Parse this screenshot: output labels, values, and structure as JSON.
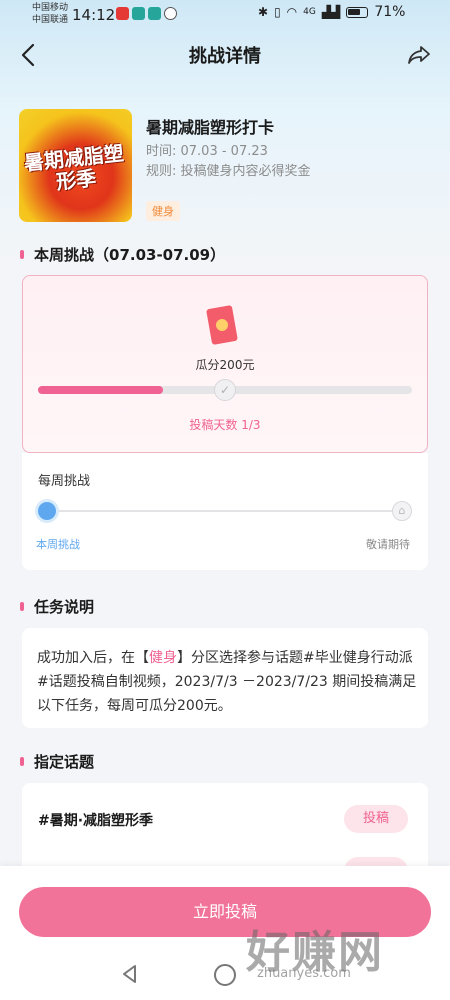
{
  "status_bar": {
    "carrier1": "中国移动",
    "carrier2": "中国联通",
    "time": "14:12",
    "network": "4G",
    "battery": "71%"
  },
  "header": {
    "title": "挑战详情"
  },
  "challenge": {
    "cover_text": "暑期减脂塑形季",
    "name": "暑期减脂塑形打卡",
    "time": "时间:  07.03 - 07.23",
    "rule": "规则:  投稿健身内容必得奖金",
    "tag": "健身"
  },
  "weekly": {
    "section_title": "本周挑战（07.03-07.09）",
    "reward": "瓜分200元",
    "progress_label": "投稿天数 1/3",
    "progress": {
      "current": 1,
      "total": 3
    },
    "panel_label": "每周挑战",
    "timeline_start": "本周挑战",
    "timeline_end": "敬请期待"
  },
  "task": {
    "section_title": "任务说明",
    "text_before": "成功加入后，在【",
    "highlight": "健身",
    "text_after": "】分区选择参与话题#毕业健身行动派#话题投稿自制视频，2023/7/3 －2023/7/23 期间投稿满足以下任务，每周可瓜分200元。"
  },
  "topics": {
    "section_title": "指定话题",
    "items": [
      {
        "name": "#暑期·减脂塑形季",
        "button": "投稿"
      }
    ]
  },
  "bottom": {
    "submit_label": "立即投稿"
  },
  "watermark": {
    "text": "好赚网",
    "url": "zhuanyes.com"
  },
  "colors": {
    "accent": "#f06292",
    "button": "#f27399",
    "blue": "#5fa8ef",
    "tag": "#f08a3a"
  }
}
